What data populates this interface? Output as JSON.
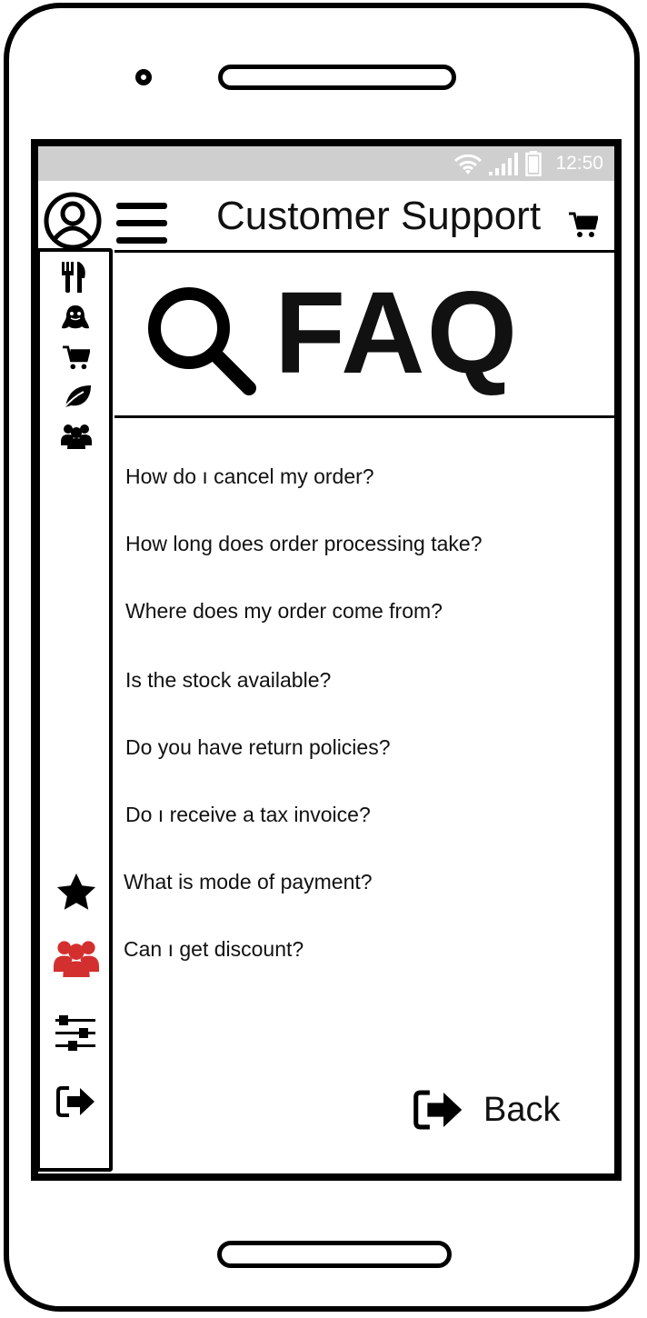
{
  "status": {
    "time": "12:50"
  },
  "header": {
    "title": "Customer Support"
  },
  "faq": {
    "heading": "FAQ",
    "questions": [
      "How do ı cancel my order?",
      "How long does order processing take?",
      "Where does my order come from?",
      "Is the stock available?",
      "Do you have return policies?",
      "Do ı receive a tax invoice?",
      "What is mode of payment?",
      "Can ı get discount?"
    ]
  },
  "back": {
    "label": "Back"
  },
  "icons": {
    "sidebar_top": [
      "cutlery-icon",
      "ghost-icon",
      "cart-icon",
      "leaf-icon",
      "group-icon"
    ],
    "sidebar_bottom": [
      "star-icon",
      "group-icon-active",
      "sliders-icon",
      "sign-out-icon"
    ]
  },
  "colors": {
    "accent": "#d32f2f",
    "statusbar": "#cfcfcf"
  }
}
